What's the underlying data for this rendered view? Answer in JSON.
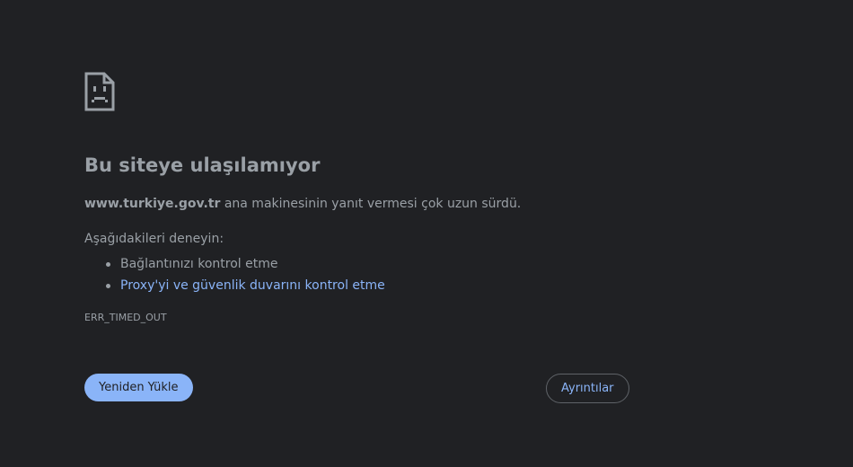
{
  "page": {
    "background": "#202124",
    "text_color": "#9aa0a6",
    "link_color": "#8ab4f8"
  },
  "icon": "sad-page-icon",
  "heading": "Bu siteye ulaşılamıyor",
  "summary": {
    "host": "www.turkiye.gov.tr",
    "message": " ana makinesinin yanıt vermesi çok uzun sürdü."
  },
  "suggestions": {
    "label": "Aşağıdakileri deneyin:",
    "items": [
      {
        "text": "Bağlantınızı kontrol etme",
        "link": false
      },
      {
        "text": "Proxy'yi ve güvenlik duvarını kontrol etme",
        "link": true
      }
    ]
  },
  "error_code": "ERR_TIMED_OUT",
  "buttons": {
    "reload": "Yeniden Yükle",
    "details": "Ayrıntılar"
  }
}
